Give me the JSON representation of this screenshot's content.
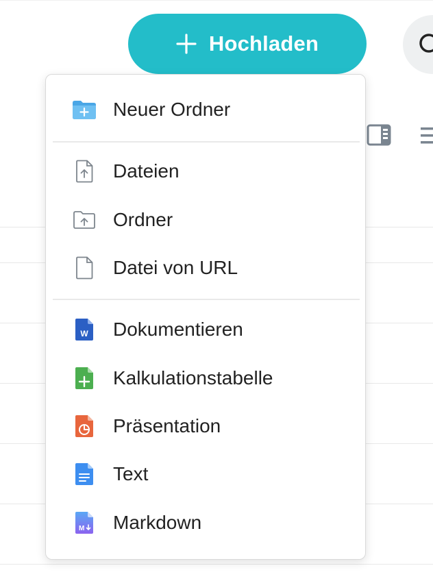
{
  "toolbar": {
    "upload_label": "Hochladen",
    "accent_color": "#23bdc9"
  },
  "icons": {
    "plus": "plus-icon",
    "search": "search-icon",
    "details_panel": "details-panel-icon",
    "list_view": "list-view-icon"
  },
  "menu": {
    "new_folder": {
      "label": "Neuer Ordner",
      "icon": "new-folder-icon"
    },
    "upload_items": [
      {
        "label": "Dateien",
        "icon": "file-upload-icon"
      },
      {
        "label": "Ordner",
        "icon": "folder-upload-icon"
      },
      {
        "label": "Datei von URL",
        "icon": "file-url-icon"
      }
    ],
    "create_items": [
      {
        "label": "Dokumentieren",
        "icon": "word-document-icon",
        "color": "#2b5fc4"
      },
      {
        "label": "Kalkulationstabelle",
        "icon": "spreadsheet-icon",
        "color": "#4caf50"
      },
      {
        "label": "Präsentation",
        "icon": "presentation-icon",
        "color": "#e8663d"
      },
      {
        "label": "Text",
        "icon": "text-file-icon",
        "color": "#3d8ef0"
      },
      {
        "label": "Markdown",
        "icon": "markdown-file-icon",
        "color": "#7b6cf0"
      }
    ]
  }
}
